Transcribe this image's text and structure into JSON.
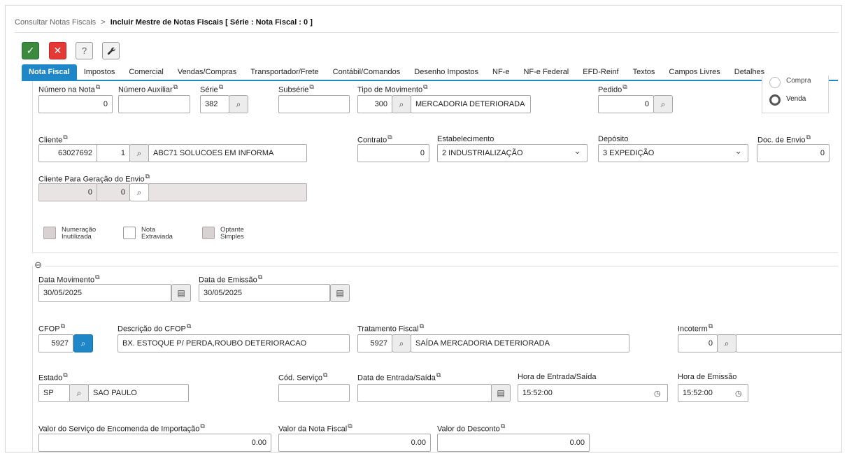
{
  "breadcrumb": {
    "parent": "Consultar Notas Fiscais",
    "separator": ">",
    "current": "Incluir Mestre de Notas Fiscais [ Série : Nota Fiscal : 0 ]"
  },
  "toolbar": {
    "confirm_icon": "check-icon",
    "cancel_icon": "close-icon",
    "help_label": "?",
    "tools_icon": "wrench-icon"
  },
  "tabs": [
    "Nota Fiscal",
    "Impostos",
    "Comercial",
    "Vendas/Compras",
    "Transportador/Frete",
    "Contábil/Comandos",
    "Desenho Impostos",
    "NF-e",
    "NF-e Federal",
    "EFD-Reinf",
    "Textos",
    "Campos Livres",
    "Detalhes"
  ],
  "radio": {
    "compra_label": "Compra",
    "venda_label": "Venda",
    "selected": "Venda"
  },
  "header": {
    "numero_nota": {
      "label": "Número na Nota",
      "value": "0"
    },
    "numero_auxiliar": {
      "label": "Número Auxiliar",
      "value": ""
    },
    "serie": {
      "label": "Série",
      "value": "382"
    },
    "subserie": {
      "label": "Subsérie",
      "value": ""
    },
    "tipo_movimento": {
      "label": "Tipo de Movimento",
      "code": "300",
      "description": "MERCADORIA DETERIORADA"
    },
    "pedido": {
      "label": "Pedido",
      "value": "0"
    }
  },
  "cliente": {
    "label": "Cliente",
    "code": "63027692",
    "sub": "1",
    "name": "ABC71 SOLUCOES EM INFORMA"
  },
  "contrato": {
    "label": "Contrato",
    "value": "0"
  },
  "estabelecimento": {
    "label": "Estabelecimento",
    "value": "2 INDUSTRIALIZAÇÃO"
  },
  "deposito": {
    "label": "Depósito",
    "value": "3 EXPEDIÇÃO"
  },
  "doc_envio": {
    "label": "Doc. de Envio",
    "value": "0"
  },
  "cliente_envio": {
    "label": "Cliente Para Geração do Envio",
    "code": "0",
    "sub": "0",
    "name": ""
  },
  "checkboxes": [
    {
      "label": "Numeração\nInutilizada",
      "disabled": true
    },
    {
      "label": "Nota\nExtraviada",
      "disabled": false
    },
    {
      "label": "Optante\nSimples",
      "disabled": true
    }
  ],
  "collapse_icon": "⊖",
  "datas": {
    "data_movimento": {
      "label": "Data Movimento",
      "value": "30/05/2025"
    },
    "data_emissao": {
      "label": "Data de Emissão",
      "value": "30/05/2025"
    }
  },
  "cfop": {
    "label": "CFOP",
    "value": "5927"
  },
  "descricao_cfop": {
    "label": "Descrição do CFOP",
    "value": "BX. ESTOQUE P/ PERDA,ROUBO DETERIORACAO"
  },
  "tratamento_fiscal": {
    "label": "Tratamento Fiscal",
    "code": "5927",
    "description": "SAÍDA MERCADORIA DETERIORADA"
  },
  "incoterm": {
    "label": "Incoterm",
    "value": "0"
  },
  "estado": {
    "label": "Estado",
    "code": "SP",
    "name": "SAO PAULO"
  },
  "cod_servico": {
    "label": "Cód. Serviço",
    "value": ""
  },
  "data_entrada_saida": {
    "label": "Data de Entrada/Saída",
    "value": ""
  },
  "hora_entrada_saida": {
    "label": "Hora de Entrada/Saída",
    "value": "15:52:00"
  },
  "hora_emissao": {
    "label": "Hora de Emissão",
    "value": "15:52:00"
  },
  "valores": {
    "servico_importacao": {
      "label": "Valor do Serviço de Encomenda de Importação",
      "value": "0.00"
    },
    "nota_fiscal": {
      "label": "Valor da Nota Fiscal",
      "value": "0.00"
    },
    "desconto": {
      "label": "Valor do Desconto",
      "value": "0.00"
    }
  },
  "colors": {
    "accent": "#1f86c8",
    "confirm": "#3b8a3e",
    "cancel": "#e53935",
    "disabled": "#e9e4e4"
  }
}
